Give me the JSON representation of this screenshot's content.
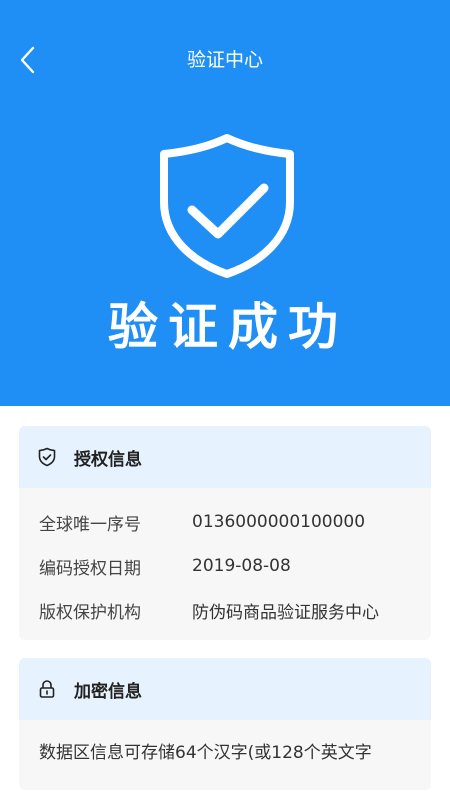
{
  "header": {
    "title": "验证中心"
  },
  "hero": {
    "status_text": "验证成功"
  },
  "auth_card": {
    "title": "授权信息",
    "rows": [
      {
        "label": "全球唯一序号",
        "value": "0136000000100000"
      },
      {
        "label": "编码授权日期",
        "value": "2019-08-08"
      },
      {
        "label": "版权保护机构",
        "value": "防伪码商品验证服务中心"
      }
    ]
  },
  "encrypt_card": {
    "title": "加密信息",
    "text": "数据区信息可存储64个汉字(或128个英文字"
  },
  "colors": {
    "brand_blue": "#1f8ff5",
    "card_header_bg": "#e6f2fd",
    "card_bg": "#f7f7f7"
  }
}
